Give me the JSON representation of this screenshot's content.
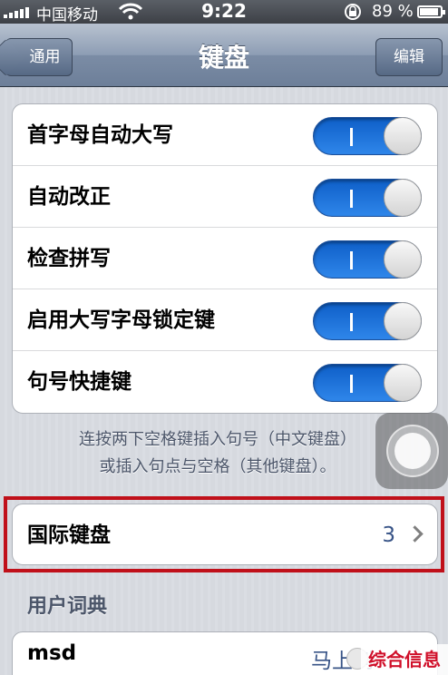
{
  "status_bar": {
    "carrier": "中国移动",
    "time": "9:22",
    "battery": "89 %",
    "battery_level": 0.89
  },
  "nav": {
    "back_label": "通用",
    "title": "键盘",
    "edit_label": "编辑"
  },
  "toggles": [
    {
      "label": "首字母自动大写",
      "on": true
    },
    {
      "label": "自动改正",
      "on": true
    },
    {
      "label": "检查拼写",
      "on": true
    },
    {
      "label": "启用大写字母锁定键",
      "on": true
    },
    {
      "label": "句号快捷键",
      "on": true
    }
  ],
  "footer_note": {
    "line1": "连按两下空格键插入句号（中文键盘）",
    "line2": "或插入句点与空格（其他键盘）。"
  },
  "international": {
    "label": "国际键盘",
    "count": "3"
  },
  "user_dict": {
    "header": "用户词典",
    "entry_word": "msd",
    "entry_phrase": "马上到"
  },
  "watermark": "综合信息",
  "colors": {
    "toggle_on": "#2f86ea",
    "highlight": "#c0101a",
    "value_text": "#385487"
  }
}
